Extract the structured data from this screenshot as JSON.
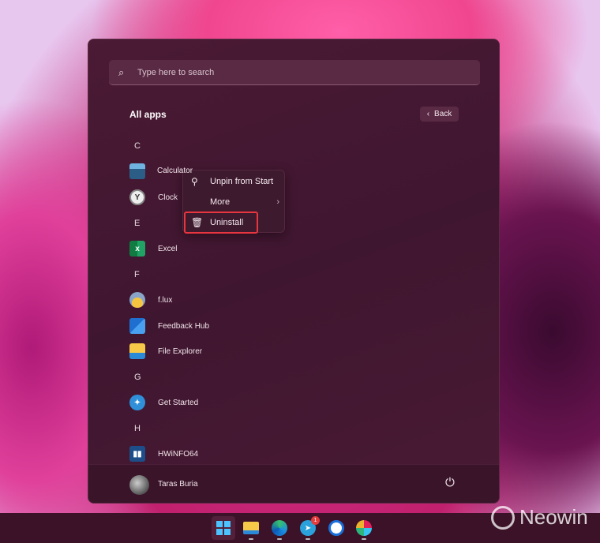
{
  "search": {
    "placeholder": "Type here to search"
  },
  "all_apps": {
    "title": "All apps",
    "back_label": "Back"
  },
  "sections": [
    {
      "letter": "C",
      "apps": [
        "Calculator",
        "Clock"
      ]
    },
    {
      "letter": "E",
      "apps": [
        "Excel"
      ]
    },
    {
      "letter": "F",
      "apps": [
        "f.lux",
        "Feedback Hub",
        "File Explorer"
      ]
    },
    {
      "letter": "G",
      "apps": [
        "Get Started"
      ]
    },
    {
      "letter": "H",
      "apps": [
        "HWiNFO64"
      ]
    }
  ],
  "calc_visible": "Calcula",
  "context_menu": {
    "items": [
      {
        "label": "Unpin from Start"
      },
      {
        "label": "More"
      },
      {
        "label": "Uninstall"
      }
    ]
  },
  "user": {
    "name": "Taras Buria"
  },
  "taskbar": {
    "telegram_badge": "1"
  },
  "watermark": "Neowin",
  "colors": {
    "highlight": "#e8353f"
  }
}
